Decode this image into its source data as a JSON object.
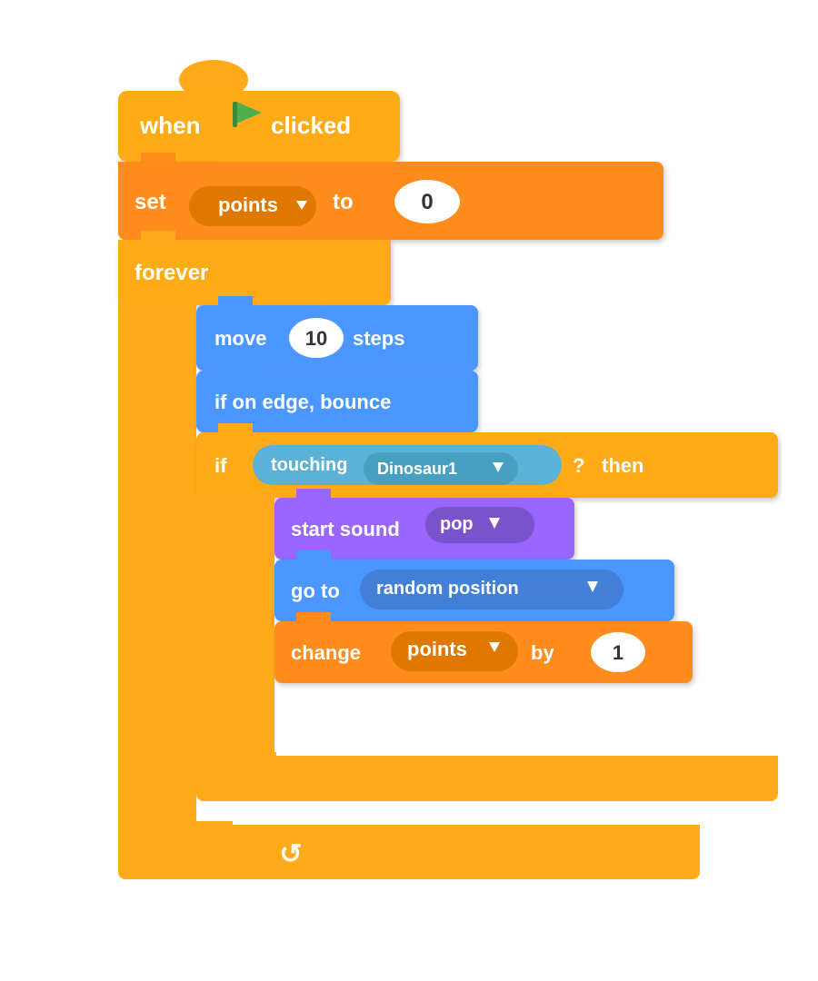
{
  "blocks": {
    "hat": {
      "label_when": "when",
      "label_clicked": "clicked",
      "flag_color": "#4CAF50"
    },
    "set": {
      "label_set": "set",
      "variable": "points",
      "label_to": "to",
      "value": "0"
    },
    "forever": {
      "label": "forever"
    },
    "move": {
      "label_move": "move",
      "steps_value": "10",
      "label_steps": "steps"
    },
    "edge": {
      "label": "if on edge, bounce"
    },
    "if_block": {
      "label_if": "if",
      "condition_touching": "touching",
      "sprite": "Dinosaur1",
      "question": "?",
      "label_then": "then"
    },
    "sound": {
      "label": "start sound",
      "sound_name": "pop"
    },
    "goto": {
      "label_go": "go to",
      "destination": "random position"
    },
    "change": {
      "label_change": "change",
      "variable": "points",
      "label_by": "by",
      "value": "1"
    }
  },
  "colors": {
    "orange": "#FFAB19",
    "orange_dark": "#FF8C1A",
    "blue": "#4C97FF",
    "blue_dark": "#4280D7",
    "teal": "#5CB1D6",
    "teal_dark": "#47a0c0",
    "purple": "#9966FF",
    "purple_dark": "#7a52cc",
    "green": "#4CAF50"
  }
}
